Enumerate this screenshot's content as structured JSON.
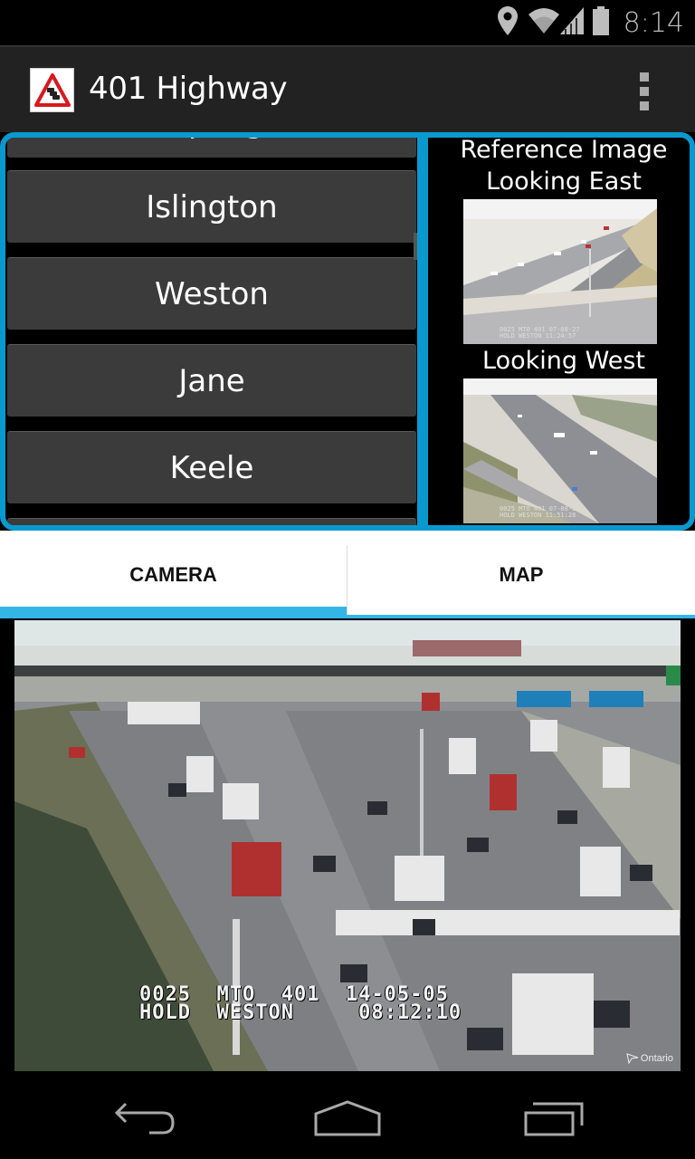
{
  "status_bar": {
    "time": "8:14",
    "icons": [
      "location-icon",
      "wifi-icon",
      "cell-signal-icon",
      "battery-icon"
    ]
  },
  "action_bar": {
    "title": "401 Highway",
    "app_icon": "traffic-warning-sign-icon",
    "overflow_icon": "overflow-menu-icon"
  },
  "station_list": {
    "items": [
      {
        "label": "Kipling"
      },
      {
        "label": "Islington"
      },
      {
        "label": "Weston"
      },
      {
        "label": "Jane"
      },
      {
        "label": "Keele"
      },
      {
        "label": ""
      }
    ]
  },
  "reference": {
    "heading": "Reference Image",
    "east_label": "Looking East",
    "west_label": "Looking West",
    "east_osd": "0025    MTO  401 07-08-27\nHOLD    WESTON    11:24:57",
    "west_osd": "0025    MTO  401 07-08-27\nHOLD    WESTON    11:51:28"
  },
  "tabs": [
    {
      "label": "CAMERA",
      "selected": true
    },
    {
      "label": "MAP",
      "selected": false
    }
  ],
  "camera": {
    "osd_line1": "0025  MTO  401  14-05-05",
    "osd_line2": "HOLD  WESTON     08:12:10",
    "watermark": "Ontario"
  },
  "nav_bar": {
    "back_icon": "back-icon",
    "home_icon": "home-icon",
    "recents_icon": "recent-apps-icon"
  },
  "colors": {
    "accent": "#33b5e5",
    "panel_border": "#0a99cf",
    "action_bar": "#222222",
    "button": "#3b3b3b"
  }
}
